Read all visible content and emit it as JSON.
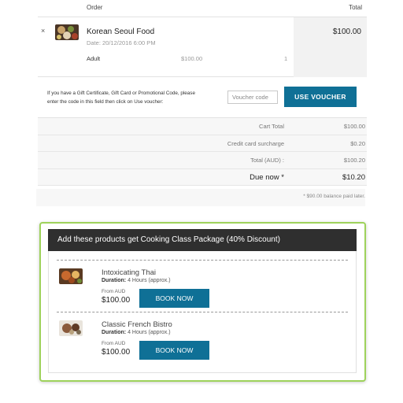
{
  "order": {
    "header": {
      "order_label": "Order",
      "total_label": "Total"
    },
    "item": {
      "remove_glyph": "×",
      "name": "Korean Seoul Food",
      "date": "Date: 20/12/2016 6:00 PM",
      "ticket_type": "Adult",
      "unit_price": "$100.00",
      "quantity": "1",
      "total": "$100.00"
    }
  },
  "voucher": {
    "instructions": "If you have a Gift Certificate, Gift Card or Promotional Code, please enter the code in this field then click on Use voucher:",
    "placeholder": "Voucher code",
    "button_label": "USE VOUCHER"
  },
  "summary": {
    "rows": [
      {
        "label": "Cart Total",
        "value": "$100.00"
      },
      {
        "label": "Credit card surcharge",
        "value": "$0.20"
      },
      {
        "label": "Total (AUD) :",
        "value": "$100.20"
      },
      {
        "label": "Due now *",
        "value": "$10.20"
      }
    ],
    "balance_note": "* $90.00 balance paid later."
  },
  "promo": {
    "title": "Add these products get Cooking Class Package (40% Discount)",
    "items": [
      {
        "name": "Intoxicating Thai",
        "duration_label": "Duration:",
        "duration_value": "4 Hours (approx.)",
        "from_label": "From AUD",
        "price": "$100.00",
        "button_label": "BOOK NOW"
      },
      {
        "name": "Classic French Bistro",
        "duration_label": "Duration:",
        "duration_value": "4 Hours (approx.)",
        "from_label": "From AUD",
        "price": "$100.00",
        "button_label": "BOOK NOW"
      }
    ]
  },
  "colors": {
    "accent_button": "#0f7096",
    "promo_border": "#9ed25b",
    "promo_header_bg": "#2f2f2f"
  },
  "icons": {
    "remove": "close-icon",
    "korean_food_thumbnail": "food-thumbnail-icon",
    "thai_food_thumbnail": "food-thumbnail-icon",
    "french_food_thumbnail": "food-thumbnail-icon"
  }
}
